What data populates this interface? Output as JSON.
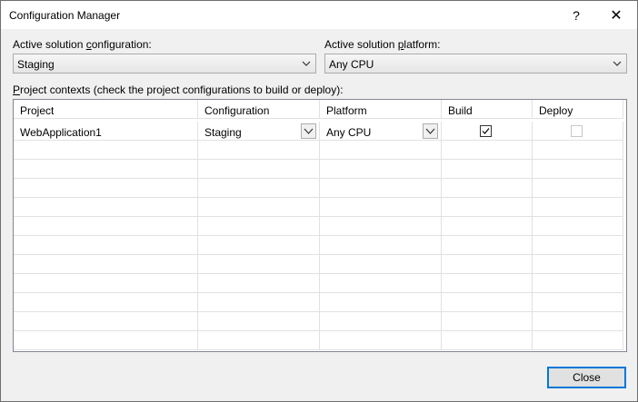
{
  "window": {
    "title": "Configuration Manager",
    "help_label": "?",
    "close_label": "✕"
  },
  "solution_config": {
    "label_pre": "Active solution ",
    "label_key": "c",
    "label_post": "onfiguration:",
    "value": "Staging"
  },
  "solution_platform": {
    "label_pre": "Active solution ",
    "label_key": "p",
    "label_post": "latform:",
    "value": "Any CPU"
  },
  "project_contexts": {
    "label_pre": "",
    "label_key": "P",
    "label_post": "roject contexts (check the project configurations to build or deploy):"
  },
  "grid": {
    "columns": [
      "Project",
      "Configuration",
      "Platform",
      "Build",
      "Deploy"
    ],
    "rows": [
      {
        "project": "WebApplication1",
        "configuration": "Staging",
        "platform": "Any CPU",
        "build": true,
        "deploy": false,
        "deploy_enabled": false
      }
    ]
  },
  "buttons": {
    "close": "Close"
  },
  "colors": {
    "accent": "#0078d7",
    "dialog_bg": "#f0f0f0",
    "grid_line": "#e1e1e1"
  }
}
